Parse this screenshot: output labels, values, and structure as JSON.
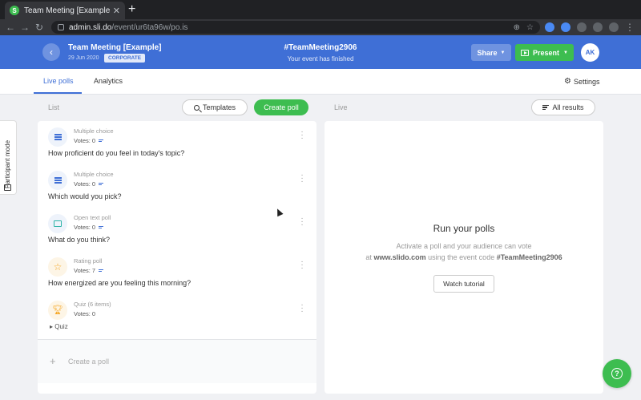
{
  "browser": {
    "tab_title": "Team Meeting [Example]",
    "tab_favicon": "S",
    "tab_close": "✕",
    "new_tab": "+",
    "url_host": "admin.sli.do",
    "url_path": "/event/ur6ta96w/po.is"
  },
  "header": {
    "event_title": "Team Meeting [Example]",
    "event_date": "29 Jun 2020",
    "event_badge": "CORPORATE",
    "event_code": "#TeamMeeting2906",
    "event_status": "Your event has finished",
    "share_label": "Share",
    "present_label": "Present",
    "avatar_initials": "AK"
  },
  "subnav": {
    "tabs": [
      {
        "label": "Live polls",
        "active": true
      },
      {
        "label": "Analytics",
        "active": false
      }
    ],
    "settings_label": "Settings"
  },
  "toolbar": {
    "list_label": "List",
    "templates_label": "Templates",
    "create_label": "Create poll",
    "live_label": "Live",
    "all_results_label": "All results"
  },
  "participant_mode_label": "Participant mode",
  "polls": [
    {
      "type": "Multiple choice",
      "votes": "Votes: 0",
      "question": "How proficient do you feel in today's topic?",
      "icon": "list-icon"
    },
    {
      "type": "Multiple choice",
      "votes": "Votes: 0",
      "question": "Which would you pick?",
      "icon": "list-icon"
    },
    {
      "type": "Open text poll",
      "votes": "Votes: 0",
      "question": "What do you think?",
      "icon": "chat-icon"
    },
    {
      "type": "Rating poll",
      "votes": "Votes: 7",
      "question": "How energized are you feeling this morning?",
      "icon": "star-icon"
    },
    {
      "type": "Quiz (6 items)",
      "votes": "Votes: 0",
      "question": "",
      "icon": "trophy-icon"
    }
  ],
  "quiz_toggle_label": "Quiz",
  "create_poll_row_label": "Create a poll",
  "live_panel": {
    "title": "Run your polls",
    "desc_line1": "Activate a poll and your audience can vote",
    "desc_prefix": "at",
    "desc_site": "www.slido.com",
    "desc_middle": "using the event code",
    "desc_code": "#TeamMeeting2906",
    "watch_label": "Watch tutorial"
  },
  "colors": {
    "brand_blue": "#3f6fd6",
    "brand_green": "#3dbd50"
  }
}
